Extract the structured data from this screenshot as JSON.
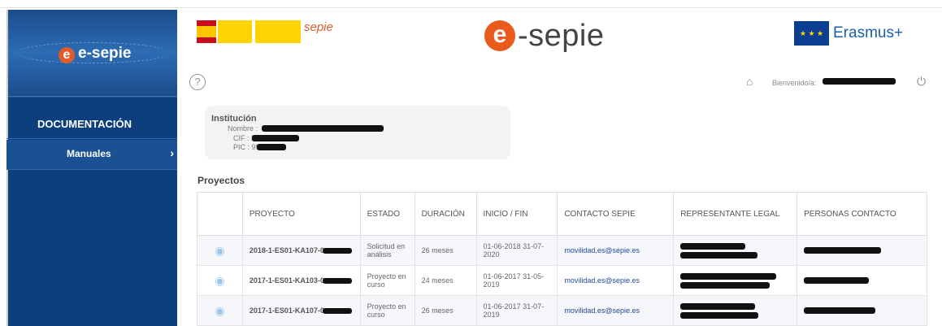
{
  "sidebar": {
    "logo_text": "e-sepie",
    "logo_mark": "e",
    "section_title": "DOCUMENTACIÓN",
    "items": [
      {
        "label": "Manuales",
        "icon": "chevron-right-icon"
      }
    ]
  },
  "header": {
    "ministry_text": "sepie",
    "brand_mark": "e",
    "brand_text": "-sepie",
    "eu_label": "Erasmus+"
  },
  "utility": {
    "help_label": "?",
    "welcome_label": "Bienvenido/a:",
    "home_icon": "home-icon",
    "power_icon": "power-icon"
  },
  "institution": {
    "title": "Institución",
    "nombre_label": "Nombre :",
    "cif_label": "CIF : ES",
    "pic_label": "PIC : 99"
  },
  "projects": {
    "title": "Proyectos",
    "columns": [
      "",
      "PROYECTO",
      "ESTADO",
      "DURACIÓN",
      "INICIO / FIN",
      "CONTACTO SEPIE",
      "REPRESENTANTE LEGAL",
      "PERSONAS CONTACTO"
    ],
    "rows": [
      {
        "code": "2018-1-ES01-KA107-0",
        "estado": "Solicitud en análisis",
        "duracion": "26 meses",
        "fechas": "01-06-2018 31-07-2020",
        "contacto": "movilidad.es@sepie.es"
      },
      {
        "code": "2017-1-ES01-KA103-0",
        "estado": "Proyecto en curso",
        "duracion": "24 meses",
        "fechas": "01-06-2017 31-05-2019",
        "contacto": "movilidad.es@sepie.es"
      },
      {
        "code": "2017-1-ES01-KA107-0",
        "estado": "Proyecto en curso",
        "duracion": "26 meses",
        "fechas": "01-06-2017 31-07-2019",
        "contacto": "movilidad.es@sepie.es"
      }
    ]
  }
}
